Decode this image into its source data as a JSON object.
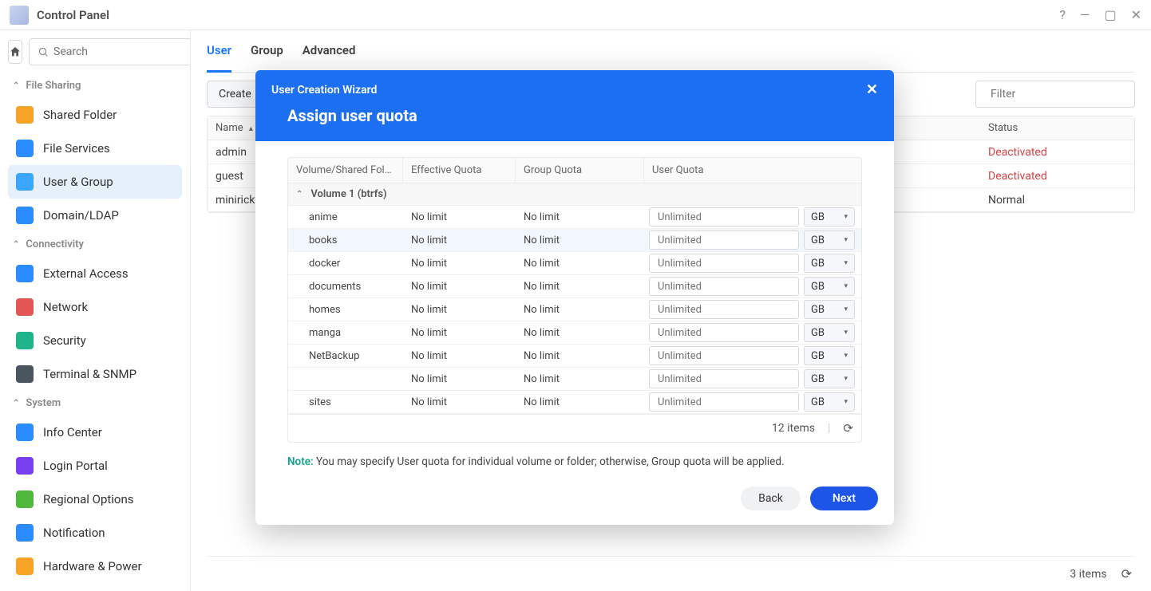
{
  "window": {
    "title": "Control Panel",
    "help_icon": "?",
    "minimize_icon": "—",
    "maximize_icon": "▢",
    "close_icon": "✕"
  },
  "sidebar": {
    "search_placeholder": "Search",
    "sections": [
      {
        "label": "File Sharing",
        "items": [
          {
            "label": "Shared Folder",
            "color": "#f7a325"
          },
          {
            "label": "File Services",
            "color": "#2a8cff"
          },
          {
            "label": "User & Group",
            "color": "#3aa6ff",
            "active": true
          },
          {
            "label": "Domain/LDAP",
            "color": "#2a8cff"
          }
        ]
      },
      {
        "label": "Connectivity",
        "items": [
          {
            "label": "External Access",
            "color": "#2a8cff"
          },
          {
            "label": "Network",
            "color": "#e45656"
          },
          {
            "label": "Security",
            "color": "#20b48a"
          },
          {
            "label": "Terminal & SNMP",
            "color": "#4a5560"
          }
        ]
      },
      {
        "label": "System",
        "items": [
          {
            "label": "Info Center",
            "color": "#2a8cff"
          },
          {
            "label": "Login Portal",
            "color": "#7b3ff2"
          },
          {
            "label": "Regional Options",
            "color": "#4fb83d"
          },
          {
            "label": "Notification",
            "color": "#2a8cff"
          },
          {
            "label": "Hardware & Power",
            "color": "#f7a325"
          }
        ]
      }
    ]
  },
  "main": {
    "tabs": [
      {
        "label": "User",
        "active": true
      },
      {
        "label": "Group",
        "active": false
      },
      {
        "label": "Advanced",
        "active": false
      }
    ],
    "toolbar": {
      "create_label": "Create",
      "filter_placeholder": "Filter"
    },
    "table": {
      "col_name": "Name",
      "col_status": "Status",
      "rows": [
        {
          "name": "admin",
          "status": "Deactivated",
          "deact": true
        },
        {
          "name": "guest",
          "status": "Deactivated",
          "deact": true
        },
        {
          "name": "miniricky",
          "status": "Normal",
          "deact": false
        }
      ]
    },
    "footer_count": "3 items"
  },
  "modal": {
    "wizard_title": "User Creation Wizard",
    "step_title": "Assign user quota",
    "cols": {
      "vs": "Volume/Shared Fol…",
      "eq": "Effective Quota",
      "gq": "Group Quota",
      "uq": "User Quota"
    },
    "group_label": "Volume 1 (btrfs)",
    "placeholder": "Unlimited",
    "unit": "GB",
    "rows": [
      {
        "name": "anime",
        "eq": "No limit",
        "gq": "No limit"
      },
      {
        "name": "books",
        "eq": "No limit",
        "gq": "No limit",
        "highlight": true
      },
      {
        "name": "docker",
        "eq": "No limit",
        "gq": "No limit"
      },
      {
        "name": "documents",
        "eq": "No limit",
        "gq": "No limit"
      },
      {
        "name": "homes",
        "eq": "No limit",
        "gq": "No limit"
      },
      {
        "name": "manga",
        "eq": "No limit",
        "gq": "No limit"
      },
      {
        "name": "NetBackup",
        "eq": "No limit",
        "gq": "No limit"
      },
      {
        "name": "",
        "eq": "No limit",
        "gq": "No limit"
      },
      {
        "name": "sites",
        "eq": "No limit",
        "gq": "No limit"
      }
    ],
    "items_count": "12 items",
    "note_label": "Note:",
    "note_text": "You may specify User quota for individual volume or folder; otherwise, Group quota will be applied.",
    "back_label": "Back",
    "next_label": "Next"
  }
}
